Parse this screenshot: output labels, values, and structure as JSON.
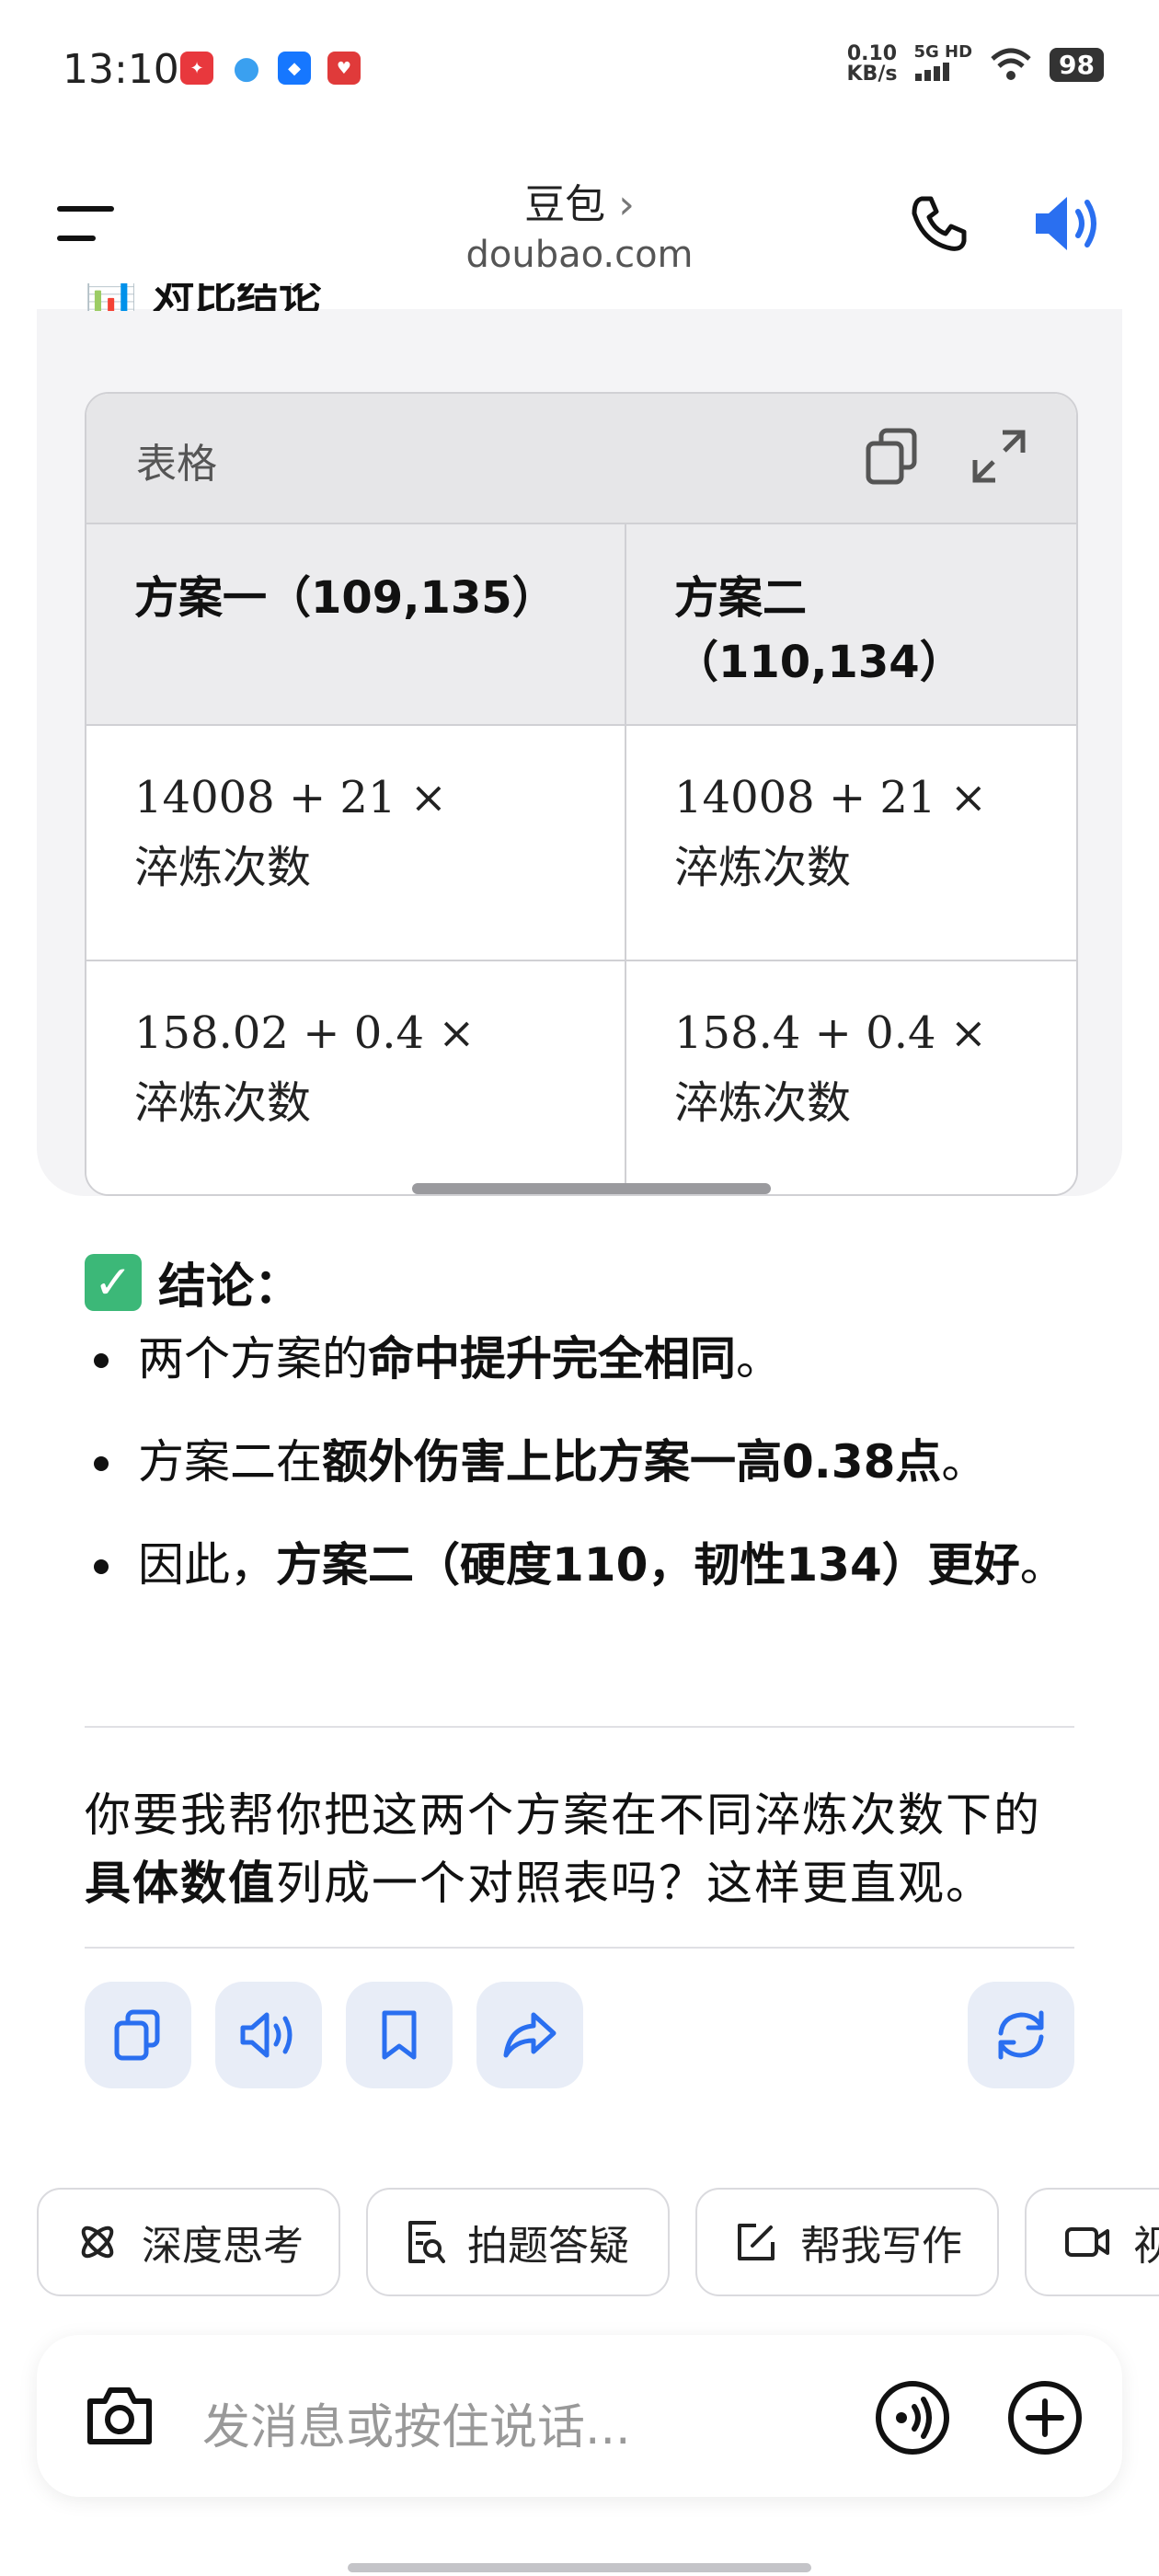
{
  "status": {
    "time": "13:10",
    "net_speed_value": "0.10",
    "net_speed_unit": "KB/s",
    "network": "5G HD",
    "battery": "98",
    "app_icons": [
      "xiaohongshu-icon",
      "qq-icon",
      "alipay-icon",
      "red-app-icon"
    ]
  },
  "header": {
    "title": "豆包",
    "domain": "doubao.com"
  },
  "message": {
    "cutoff_heading": "对比结论",
    "table": {
      "label": "表格",
      "headers": [
        "方案一（109,135）",
        "方案二（110,134）"
      ],
      "rows": [
        {
          "c1_formula": "14008 + 21 ×",
          "c1_text": "淬炼次数",
          "c2_formula": "14008 + 21 ×",
          "c2_text": "淬炼次数"
        },
        {
          "c1_formula": "158.02 + 0.4 ×",
          "c1_text": "淬炼次数",
          "c2_formula": "158.4 + 0.4 ×",
          "c2_text": "淬炼次数"
        }
      ]
    },
    "conclusion_label": "结论：",
    "bullets": [
      {
        "pre": "两个方案的",
        "bold": "命中提升完全相同",
        "post": "。"
      },
      {
        "pre": "方案二在",
        "bold": "额外伤害上比方案一高0.38点",
        "post": "。"
      },
      {
        "pre": "因此，",
        "bold": "方案二（硬度110，韧性134）更好",
        "post": "。"
      }
    ],
    "followup_pre": "你要我帮你把这两个方案在不同淬炼次数下的",
    "followup_bold": "具体数值",
    "followup_post": "列成一个对照表吗？这样更直观。"
  },
  "chips": [
    "深度思考",
    "拍题答疑",
    "帮我写作",
    "视"
  ],
  "input": {
    "placeholder": "发消息或按住说话..."
  },
  "colors": {
    "accent": "#2a6ff0",
    "card_bg": "#f4f4f6",
    "action_bg": "#e8edf7"
  }
}
